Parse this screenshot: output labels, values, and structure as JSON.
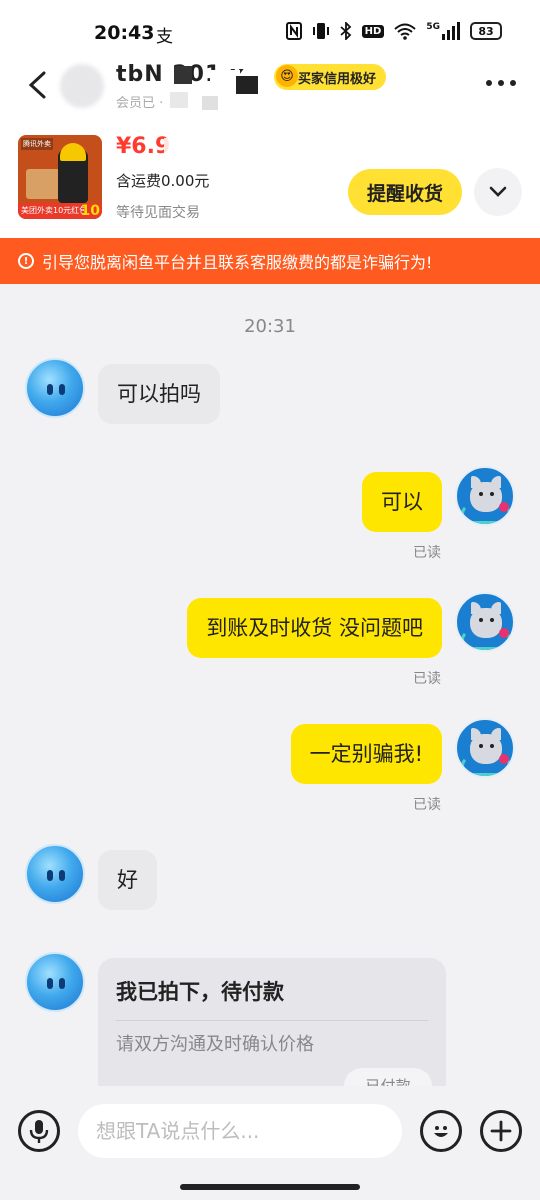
{
  "status_bar": {
    "time": "20:43",
    "alipay_glyph": "支",
    "icons": [
      "nfc-icon",
      "vibrate-icon",
      "bluetooth-icon",
      "hd-icon",
      "wifi-icon",
      "signal-5g-icon"
    ],
    "hd_label": "HD",
    "network_label": "5G",
    "battery": "83"
  },
  "header": {
    "seller_name": "tbN  201 x",
    "seller_sub": "会员已 ·",
    "credit_badge": "买家信用极好",
    "credit_emoji": "😍"
  },
  "product": {
    "price": "¥6.9",
    "shipping": "含运费0.00元",
    "trade_status": "等待见面交易",
    "remind_button": "提醒收货",
    "thumb_logo": "腾讯外卖",
    "thumb_banner": "美团外卖10元红包",
    "thumb_number": "10"
  },
  "warning": {
    "text": "引导您脱离闲鱼平台并且联系客服缴费的都是诈骗行为!"
  },
  "chat": {
    "timestamp": "20:31",
    "messages": [
      {
        "side": "in",
        "text": "可以拍吗"
      },
      {
        "side": "out",
        "text": "可以",
        "status": "已读"
      },
      {
        "side": "out",
        "text": "到账及时收货 没问题吧",
        "status": "已读"
      },
      {
        "side": "out",
        "text": "一定别骗我!",
        "status": "已读"
      },
      {
        "side": "in",
        "text": "好"
      }
    ],
    "order_card": {
      "title": "我已拍下，待付款",
      "desc": "请双方沟通及时确认价格",
      "button": "已付款"
    }
  },
  "input_bar": {
    "placeholder": "想跟TA说点什么..."
  }
}
